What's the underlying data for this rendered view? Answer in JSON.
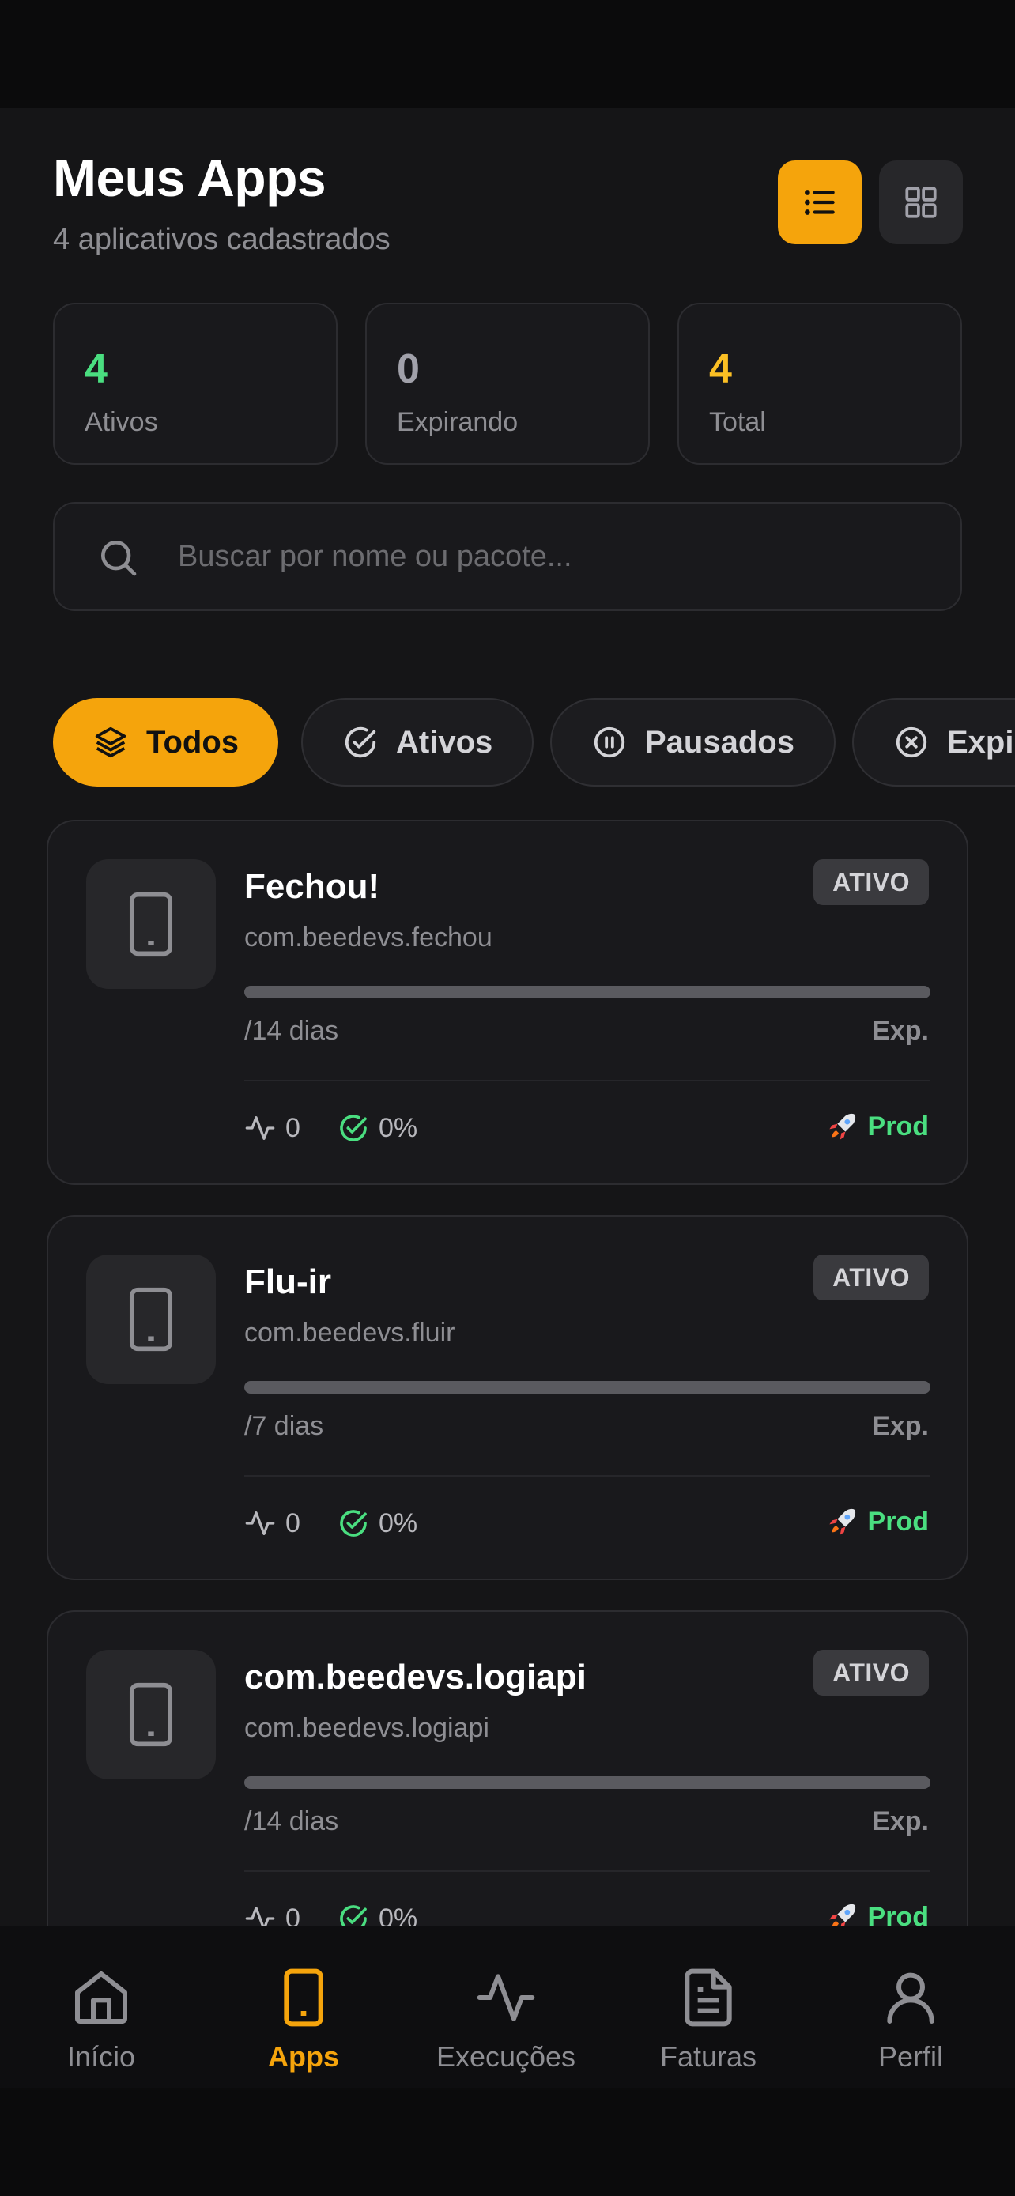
{
  "header": {
    "title": "Meus Apps",
    "subtitle": "4 aplicativos cadastrados"
  },
  "stats": [
    {
      "value": "4",
      "label": "Ativos",
      "color": "#4ade80"
    },
    {
      "value": "0",
      "label": "Expirando",
      "color": "#a1a1aa"
    },
    {
      "value": "4",
      "label": "Total",
      "color": "#fbbf24"
    }
  ],
  "search": {
    "placeholder": "Buscar por nome ou pacote..."
  },
  "filters": [
    {
      "label": "Todos",
      "icon": "layers-icon",
      "active": true
    },
    {
      "label": "Ativos",
      "icon": "check-circle-icon",
      "active": false
    },
    {
      "label": "Pausados",
      "icon": "pause-circle-icon",
      "active": false
    },
    {
      "label": "Expirados",
      "icon": "x-circle-icon",
      "active": false
    }
  ],
  "apps": [
    {
      "name": "Fechou!",
      "package": "com.beedevs.fechou",
      "status": "ATIVO",
      "days": "/14 dias",
      "exp": "Exp.",
      "executions": "0",
      "success": "0%",
      "env": "Prod",
      "progress": 0
    },
    {
      "name": "Flu-ir",
      "package": "com.beedevs.fluir",
      "status": "ATIVO",
      "days": "/7 dias",
      "exp": "Exp.",
      "executions": "0",
      "success": "0%",
      "env": "Prod",
      "progress": 0
    },
    {
      "name": "com.beedevs.logiapi",
      "package": "com.beedevs.logiapi",
      "status": "ATIVO",
      "days": "/14 dias",
      "exp": "Exp.",
      "executions": "0",
      "success": "0%",
      "env": "Prod",
      "progress": 0
    }
  ],
  "nav": [
    {
      "label": "Início",
      "icon": "home-icon",
      "active": false
    },
    {
      "label": "Apps",
      "icon": "smartphone-icon",
      "active": true
    },
    {
      "label": "Execuções",
      "icon": "activity-icon",
      "active": false
    },
    {
      "label": "Faturas",
      "icon": "file-text-icon",
      "active": false
    },
    {
      "label": "Perfil",
      "icon": "user-icon",
      "active": false
    }
  ],
  "colors": {
    "accent": "#f5a40c",
    "success": "#4ade80",
    "background": "#151517"
  }
}
